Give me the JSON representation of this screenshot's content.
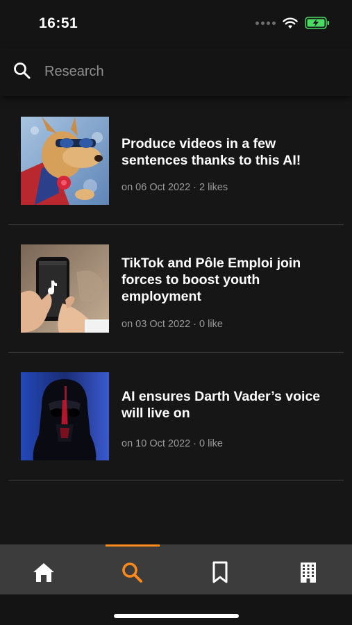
{
  "status_bar": {
    "time": "16:51"
  },
  "search": {
    "placeholder": "Research",
    "value": ""
  },
  "articles": [
    {
      "title": "Produce videos in a few sentences thanks to this AI!",
      "meta": "on 06 Oct 2022 · 2 likes",
      "thumbnail": "dog-sunglasses-superhero-image"
    },
    {
      "title": "TikTok and Pôle Emploi join forces to boost youth employment",
      "meta": "on 03 Oct 2022 · 0 like",
      "thumbnail": "hand-holding-phone-tiktok-image"
    },
    {
      "title": "AI ensures Darth Vader’s voice will live on",
      "meta": "on 10 Oct 2022 · 0 like",
      "thumbnail": "darth-vader-helmet-image"
    }
  ],
  "bottom_nav": {
    "items": [
      "home-icon",
      "search-icon",
      "bookmark-icon",
      "building-icon"
    ],
    "active": "search-icon",
    "active_color": "#ff8a1c",
    "inactive_color": "#ffffff"
  },
  "colors": {
    "background": "#161616",
    "accent": "#ff8a1c",
    "battery": "#4cd964"
  }
}
